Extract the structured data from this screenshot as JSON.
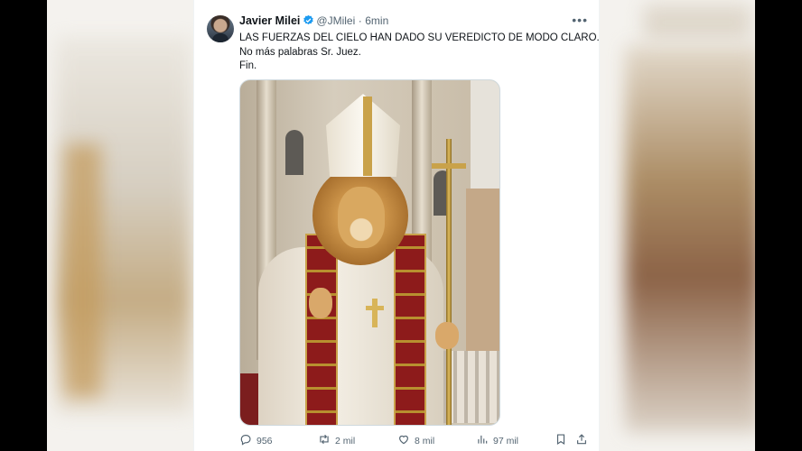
{
  "tweet": {
    "author_name": "Javier Milei",
    "handle": "@JMilei",
    "separator": "·",
    "time": "6min",
    "more_label": "•••",
    "lines": [
      "LAS FUERZAS DEL CIELO HAN DADO SU VEREDICTO DE MODO CLARO.",
      "No más palabras Sr. Juez.",
      "Fin."
    ]
  },
  "actions": {
    "reply_count": "956",
    "retweet_count": "2 mil",
    "like_count": "8 mil",
    "views_count": "97 mil"
  },
  "icons": {
    "verified": "verified-badge-icon",
    "reply": "reply-icon",
    "retweet": "retweet-icon",
    "like": "heart-icon",
    "views": "views-icon",
    "bookmark": "bookmark-icon",
    "share": "share-icon"
  },
  "colors": {
    "text_primary": "#0f1419",
    "text_secondary": "#536471",
    "verified_blue": "#1d9bf0"
  }
}
